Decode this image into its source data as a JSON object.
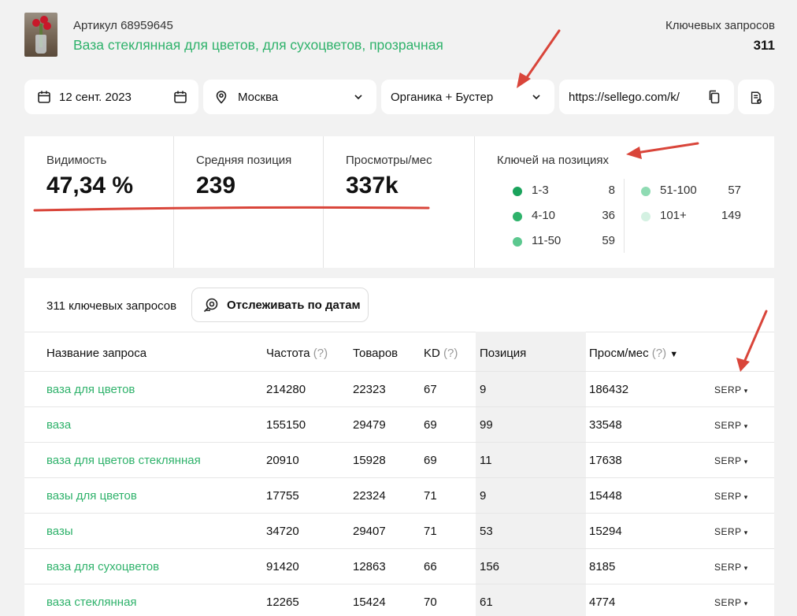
{
  "product": {
    "artikul": "Артикул 68959645",
    "title": "Ваза стеклянная для цветов, для сухоцветов, прозрачная",
    "keywords_label": "Ключевых запросов",
    "keywords_count": "311"
  },
  "filters": {
    "date": "12 сент. 2023",
    "city": "Москва",
    "source": "Органика + Бустер",
    "url": "https://sellego.com/k/"
  },
  "stats": {
    "visibility_label": "Видимость",
    "visibility_value": "47,34 %",
    "avg_pos_label": "Средняя позиция",
    "avg_pos_value": "239",
    "views_label": "Просмотры/мес",
    "views_value": "337k",
    "keys_title": "Ключей на позициях",
    "buckets": [
      {
        "range": "1-3",
        "count": "8",
        "color": "#1aa35c"
      },
      {
        "range": "4-10",
        "count": "36",
        "color": "#2fb26b"
      },
      {
        "range": "11-50",
        "count": "59",
        "color": "#5cc88f"
      },
      {
        "range": "51-100",
        "count": "57",
        "color": "#8fdbb3"
      },
      {
        "range": "101+",
        "count": "149",
        "color": "#d4f1e2"
      }
    ]
  },
  "table": {
    "total_label": "311 ключевых запросов",
    "track_label": "Отслеживать по датам",
    "headers": {
      "query": "Название запроса",
      "freq": "Частота",
      "goods": "Товаров",
      "kd": "KD",
      "pos": "Позиция",
      "views": "Просм/мес",
      "hint": "(?)",
      "sort_arrow": "▼"
    },
    "serp_label": "SERP",
    "rows": [
      {
        "query": "ваза для цветов",
        "freq": "214280",
        "goods": "22323",
        "kd": "67",
        "pos": "9",
        "views": "186432"
      },
      {
        "query": "ваза",
        "freq": "155150",
        "goods": "29479",
        "kd": "69",
        "pos": "99",
        "views": "33548"
      },
      {
        "query": "ваза для цветов стеклянная",
        "freq": "20910",
        "goods": "15928",
        "kd": "69",
        "pos": "11",
        "views": "17638"
      },
      {
        "query": "вазы для цветов",
        "freq": "17755",
        "goods": "22324",
        "kd": "71",
        "pos": "9",
        "views": "15448"
      },
      {
        "query": "вазы",
        "freq": "34720",
        "goods": "29407",
        "kd": "71",
        "pos": "53",
        "views": "15294"
      },
      {
        "query": "ваза для сухоцветов",
        "freq": "91420",
        "goods": "12863",
        "kd": "66",
        "pos": "156",
        "views": "8185"
      },
      {
        "query": "ваза стеклянная",
        "freq": "12265",
        "goods": "15424",
        "kd": "70",
        "pos": "61",
        "views": "4774"
      }
    ]
  },
  "colors": {
    "accent_green": "#2fb26b",
    "annotation_red": "#d9453a"
  }
}
